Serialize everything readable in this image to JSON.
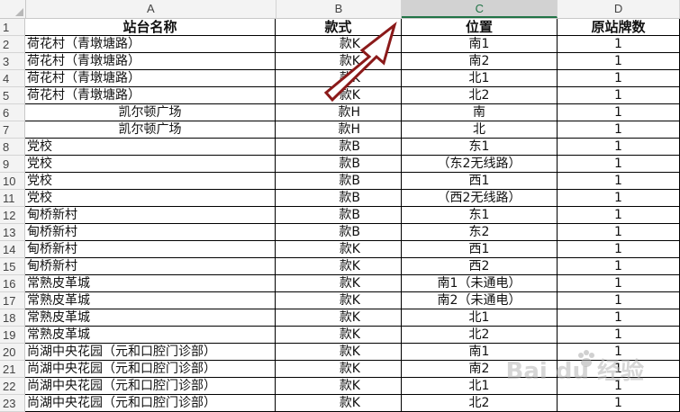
{
  "columns": [
    "A",
    "B",
    "C",
    "D"
  ],
  "selected_column": "C",
  "rows": [
    {
      "n": "1",
      "a": "站台名称",
      "b": "款式",
      "c": "位置",
      "d": "原站牌数",
      "header": true
    },
    {
      "n": "2",
      "a": "荷花村（青墩塘路）",
      "b": "款K",
      "c": "南1",
      "d": "1"
    },
    {
      "n": "3",
      "a": "荷花村（青墩塘路）",
      "b": "款K",
      "c": "南2",
      "d": "1"
    },
    {
      "n": "4",
      "a": "荷花村（青墩塘路）",
      "b": "款K",
      "c": "北1",
      "d": "1"
    },
    {
      "n": "5",
      "a": "荷花村（青墩塘路）",
      "b": "款K",
      "c": "北2",
      "d": "1"
    },
    {
      "n": "6",
      "a": "凯尔顿广场",
      "b": "款H",
      "c": "南",
      "d": "1",
      "a_center": true
    },
    {
      "n": "7",
      "a": "凯尔顿广场",
      "b": "款H",
      "c": "北",
      "d": "1",
      "a_center": true
    },
    {
      "n": "8",
      "a": "党校",
      "b": "款B",
      "c": "东1",
      "d": "1"
    },
    {
      "n": "9",
      "a": "党校",
      "b": "款B",
      "c": "（东2无线路）",
      "d": "1"
    },
    {
      "n": "10",
      "a": "党校",
      "b": "款B",
      "c": "西1",
      "d": "1"
    },
    {
      "n": "11",
      "a": "党校",
      "b": "款B",
      "c": "（西2无线路）",
      "d": "1"
    },
    {
      "n": "12",
      "a": "甸桥新村",
      "b": "款B",
      "c": "东1",
      "d": "1"
    },
    {
      "n": "13",
      "a": "甸桥新村",
      "b": "款B",
      "c": "东2",
      "d": "1"
    },
    {
      "n": "14",
      "a": "甸桥新村",
      "b": "款K",
      "c": "西1",
      "d": "1"
    },
    {
      "n": "15",
      "a": "甸桥新村",
      "b": "款K",
      "c": "西2",
      "d": "1"
    },
    {
      "n": "16",
      "a": "常熟皮革城",
      "b": "款K",
      "c": "南1（未通电）",
      "d": "1"
    },
    {
      "n": "17",
      "a": "常熟皮革城",
      "b": "款K",
      "c": "南2（未通电）",
      "d": "1"
    },
    {
      "n": "18",
      "a": "常熟皮革城",
      "b": "款K",
      "c": "北1",
      "d": "1"
    },
    {
      "n": "19",
      "a": "常熟皮革城",
      "b": "款K",
      "c": "北2",
      "d": "1"
    },
    {
      "n": "20",
      "a": "尚湖中央花园（元和口腔门诊部）",
      "b": "款K",
      "c": "南1",
      "d": "1"
    },
    {
      "n": "21",
      "a": "尚湖中央花园（元和口腔门诊部）",
      "b": "款K",
      "c": "南2",
      "d": "1"
    },
    {
      "n": "22",
      "a": "尚湖中央花园（元和口腔门诊部）",
      "b": "款K",
      "c": "北1",
      "d": "1"
    },
    {
      "n": "23",
      "a": "尚湖中央花园（元和口腔门诊部）",
      "b": "款K",
      "c": "北2",
      "d": "1"
    }
  ],
  "annotation": {
    "type": "arrow",
    "color": "#8b1a1a",
    "icon": "arrow-annotation-icon"
  },
  "watermark": {
    "text": "Bai du 经验"
  }
}
